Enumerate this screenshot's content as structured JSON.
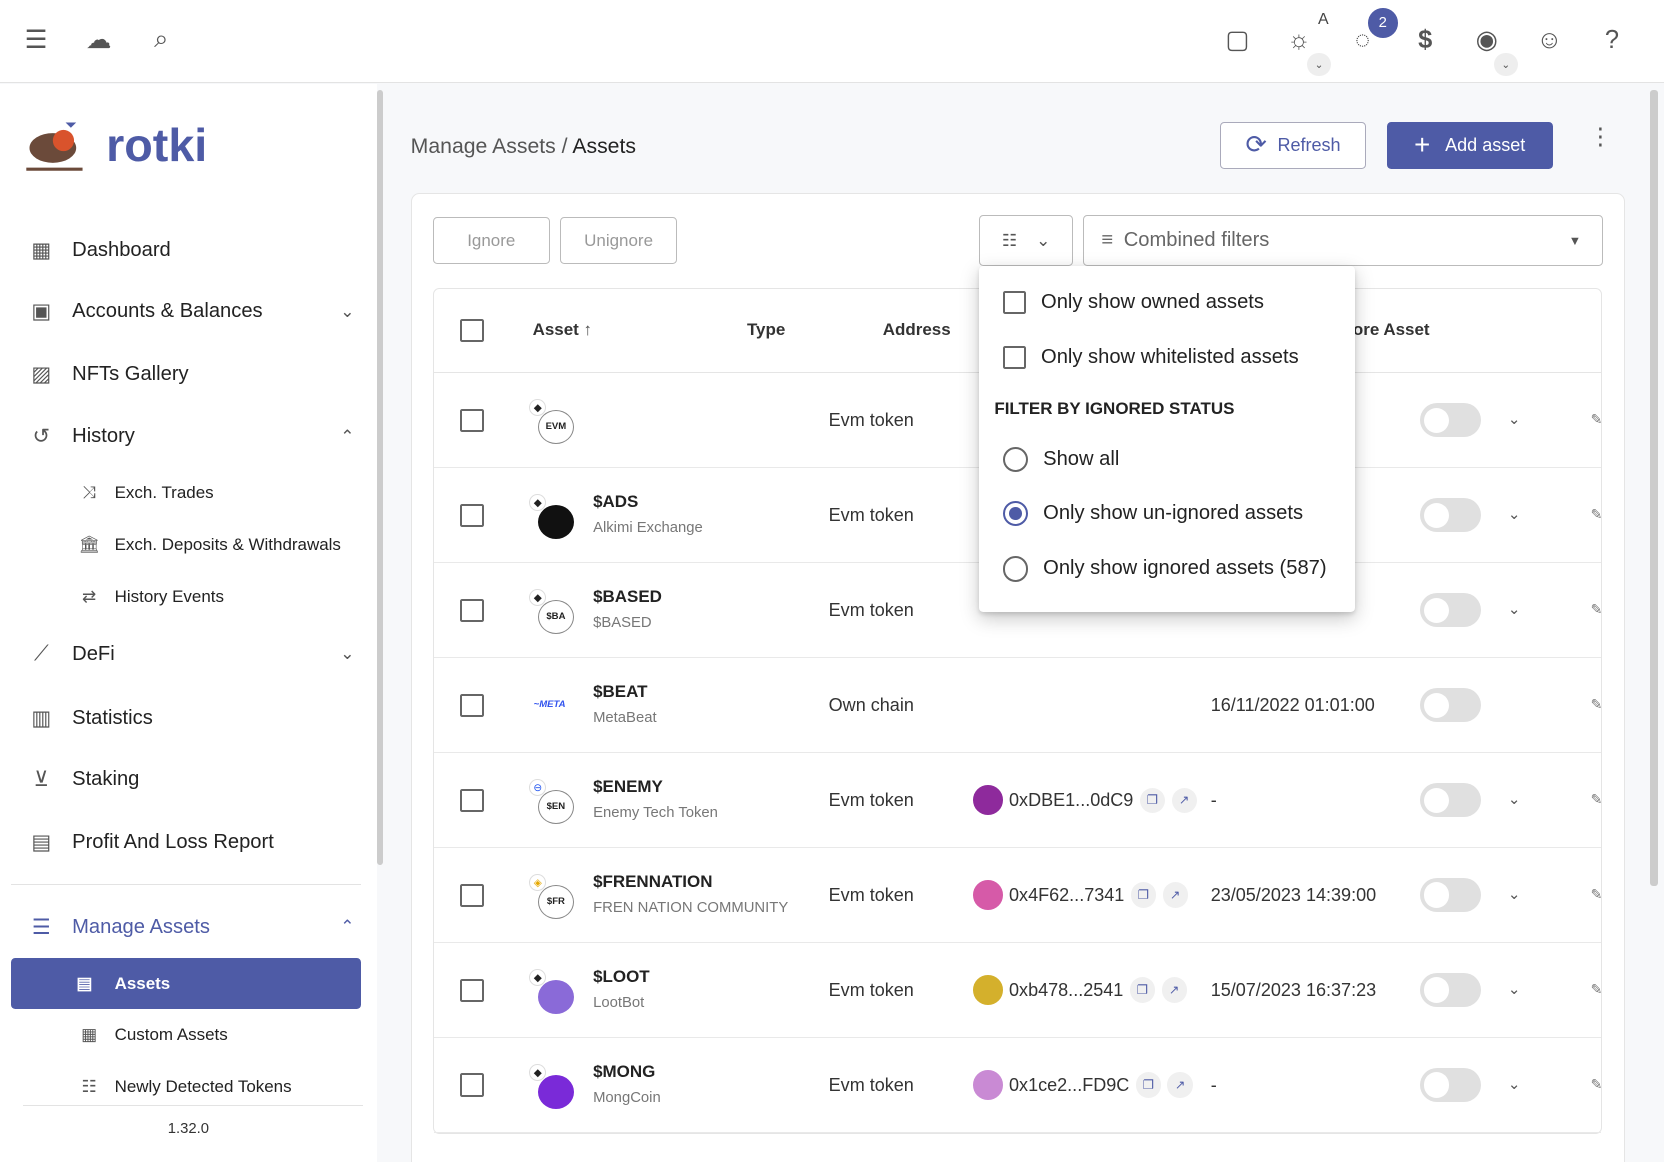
{
  "topbar": {
    "icons": [
      "menu-icon",
      "cloud-off-icon",
      "search-icon",
      "note-icon",
      "theme-sun-icon",
      "pending-tasks-icon",
      "currency-dollar-icon",
      "privacy-eye-icon",
      "account-icon",
      "help-icon"
    ],
    "theme_mode": "A",
    "badge_count": "2",
    "currency_symbol": "$"
  },
  "sidebar": {
    "brand": "rotki",
    "items": [
      {
        "label": "Dashboard",
        "icon": "dashboard-icon"
      },
      {
        "label": "Accounts & Balances",
        "icon": "wallet-icon"
      },
      {
        "label": "NFTs Gallery",
        "icon": "image-icon"
      },
      {
        "label": "History",
        "icon": "history-icon"
      },
      {
        "label": "DeFi",
        "icon": "chart-line-icon"
      },
      {
        "label": "Statistics",
        "icon": "statistics-icon"
      },
      {
        "label": "Staking",
        "icon": "staking-icon"
      },
      {
        "label": "Profit And Loss Report",
        "icon": "calculator-icon"
      },
      {
        "label": "Manage Assets",
        "icon": "database-icon"
      }
    ],
    "history_sub": [
      "Exch. Trades",
      "Exch. Deposits & Withdrawals",
      "History Events"
    ],
    "assets_sub": [
      "Assets",
      "Custom Assets",
      "Newly Detected Tokens"
    ],
    "version": "1.32.0"
  },
  "header": {
    "breadcrumb_parent": "Manage Assets",
    "breadcrumb_sep": "/",
    "breadcrumb_current": "Assets",
    "refresh": "Refresh",
    "add_asset": "Add asset"
  },
  "toolbar": {
    "ignore": "Ignore",
    "unignore": "Unignore",
    "combined_filters": "Combined filters"
  },
  "table": {
    "headers": {
      "asset": "Asset",
      "type": "Type",
      "address": "Address",
      "ignore": "Ignore Asset"
    },
    "rows": [
      {
        "symbol": "",
        "name": "",
        "icon_text": "EVM",
        "type": "Evm token",
        "address": "",
        "date": ""
      },
      {
        "symbol": "$ADS",
        "name": "Alkimi Exchange",
        "icon_text": "",
        "type": "Evm token",
        "address": "",
        "date": ""
      },
      {
        "symbol": "$BASED",
        "name": "$BASED",
        "icon_text": "$BA",
        "type": "Evm token",
        "address": "",
        "date": ""
      },
      {
        "symbol": "$BEAT",
        "name": "MetaBeat",
        "icon_text": "",
        "type": "Own chain",
        "address": "",
        "date": "16/11/2022 01:01:00"
      },
      {
        "symbol": "$ENEMY",
        "name": "Enemy Tech Token",
        "icon_text": "$EN",
        "type": "Evm token",
        "address": "0xDBE1...0dC9",
        "date": "-"
      },
      {
        "symbol": "$FRENNATION",
        "name": "FREN NATION COMMUNITY",
        "icon_text": "$FR",
        "type": "Evm token",
        "address": "0x4F62...7341",
        "date": "23/05/2023 14:39:00"
      },
      {
        "symbol": "$LOOT",
        "name": "LootBot",
        "icon_text": "",
        "type": "Evm token",
        "address": "0xb478...2541",
        "date": "15/07/2023 16:37:23"
      },
      {
        "symbol": "$MONG",
        "name": "MongCoin",
        "icon_text": "",
        "type": "Evm token",
        "address": "0x1ce2...FD9C",
        "date": "-"
      }
    ]
  },
  "filter_menu": {
    "owned": "Only show owned assets",
    "owned_checked": false,
    "whitelisted": "Only show whitelisted assets",
    "whitelisted_checked": false,
    "section": "FILTER BY IGNORED STATUS",
    "show_all": "Show all",
    "unignored": "Only show un-ignored assets",
    "ignored": "Only show ignored assets (587)",
    "selected": "unignored"
  },
  "colors": {
    "primary": "#4e5ba6"
  }
}
